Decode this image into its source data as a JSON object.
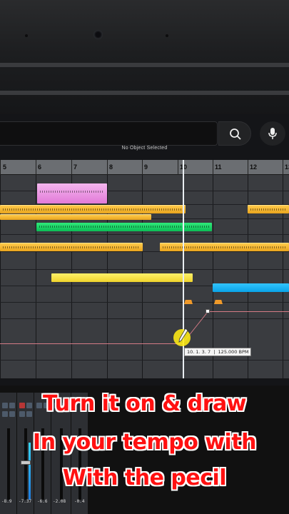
{
  "top": {
    "search_icon": "search-icon",
    "mic_icon": "microphone-icon",
    "status_text": "No Object Selected"
  },
  "ruler": {
    "bars": [
      "5",
      "6",
      "7",
      "8",
      "9",
      "10",
      "11",
      "12",
      "13"
    ]
  },
  "tooltip": {
    "position": "10. 1. 3. 7",
    "tempo": "125.000 BPM"
  },
  "mixer": {
    "readouts": [
      "-7.37",
      "-6.6",
      "-2.08",
      "-0.4",
      "-8.9",
      "-6.9"
    ]
  },
  "caption": {
    "line1": "Turn it on & draw",
    "line2": "In your tempo with",
    "line3": "With the pecil"
  },
  "colors": {
    "orange": "#f2b42e",
    "green": "#19d463",
    "yellow": "#f6e33f",
    "blue": "#1ab5f5",
    "pink": "#eb98e3",
    "tempo_line": "#d57b86",
    "caption": "#ff1111"
  }
}
